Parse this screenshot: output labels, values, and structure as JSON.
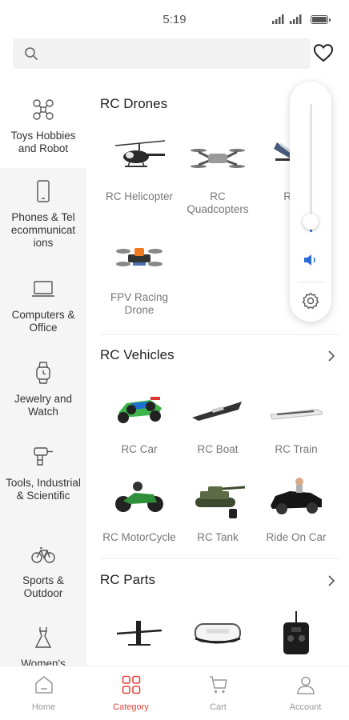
{
  "status_bar": {
    "time": "5:19",
    "signal_1": "⁴ᴳ",
    "signal_2": "⁴ᴳ"
  },
  "search": {
    "placeholder": ""
  },
  "colors": {
    "accent": "#e8453c",
    "volume_fill": "#2b6bd6"
  },
  "sidebar": {
    "items": [
      {
        "label": "Toys Hobbies and Robot",
        "icon": "drone-icon",
        "active": true
      },
      {
        "label": "Phones & Tel ecommunicat ions",
        "icon": "phone-icon",
        "active": false
      },
      {
        "label": "Computers & Office",
        "icon": "laptop-icon",
        "active": false
      },
      {
        "label": "Jewelry and Watch",
        "icon": "watch-icon",
        "active": false
      },
      {
        "label": "Tools, Industrial & Scientific",
        "icon": "drill-icon",
        "active": false
      },
      {
        "label": "Sports & Outdoor",
        "icon": "bicycle-icon",
        "active": false
      },
      {
        "label": "Women's",
        "icon": "dress-icon",
        "active": false
      }
    ]
  },
  "sections": [
    {
      "title": "RC Drones",
      "items": [
        {
          "label": "RC Helicopter",
          "icon": "helicopter-image"
        },
        {
          "label": "RC Quadcopters",
          "icon": "quadcopter-image"
        },
        {
          "label": "RC A",
          "icon": "airplane-image"
        },
        {
          "label": "FPV Racing Drone",
          "icon": "fpv-drone-image"
        }
      ]
    },
    {
      "title": "RC Vehicles",
      "items": [
        {
          "label": "RC Car",
          "icon": "rc-car-image"
        },
        {
          "label": "RC Boat",
          "icon": "rc-boat-image"
        },
        {
          "label": "RC Train",
          "icon": "rc-train-image"
        },
        {
          "label": "RC MotorCycle",
          "icon": "rc-motorcycle-image"
        },
        {
          "label": "RC Tank",
          "icon": "rc-tank-image"
        },
        {
          "label": "Ride On Car",
          "icon": "ride-on-car-image"
        }
      ]
    },
    {
      "title": "RC Parts",
      "items": [
        {
          "label": "",
          "icon": "propeller-image"
        },
        {
          "label": "",
          "icon": "fpv-goggles-image"
        },
        {
          "label": "",
          "icon": "transmitter-image"
        }
      ]
    }
  ],
  "volume": {
    "level": 0.08
  },
  "bottom_nav": {
    "tabs": [
      {
        "label": "Home",
        "icon": "home-icon",
        "active": false
      },
      {
        "label": "Category",
        "icon": "category-grid-icon",
        "active": true
      },
      {
        "label": "Cart",
        "icon": "cart-icon",
        "active": false
      },
      {
        "label": "Account",
        "icon": "account-icon",
        "active": false
      }
    ]
  }
}
